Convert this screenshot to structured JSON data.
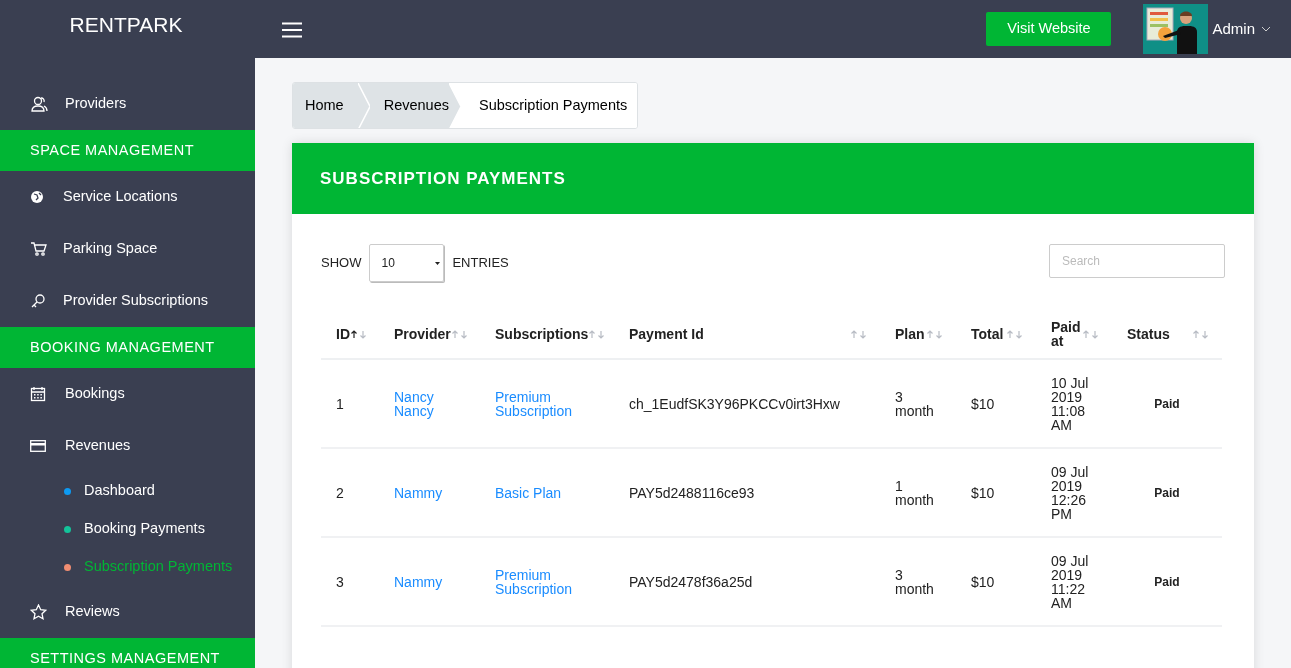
{
  "brand": "RENTPARK",
  "header": {
    "visit_button": "Visit Website",
    "user": "Admin"
  },
  "sidebar": [
    {
      "kind": "item",
      "label": "Providers"
    },
    {
      "kind": "section",
      "label": "SPACE MANAGEMENT"
    },
    {
      "kind": "item",
      "label": "Service Locations"
    },
    {
      "kind": "item",
      "label": "Parking Space"
    },
    {
      "kind": "item",
      "label": "Provider Subscriptions"
    },
    {
      "kind": "section",
      "label": "BOOKING MANAGEMENT"
    },
    {
      "kind": "item",
      "label": "Bookings"
    },
    {
      "kind": "item",
      "label": "Revenues"
    },
    {
      "kind": "subitem",
      "label": "Dashboard",
      "color": "#0d9af2",
      "selected": false
    },
    {
      "kind": "subitem",
      "label": "Booking Payments",
      "color": "#13c39a",
      "selected": false
    },
    {
      "kind": "subitem",
      "label": "Subscription Payments",
      "color": "#f08d72",
      "selected": true
    },
    {
      "kind": "item",
      "label": "Reviews"
    },
    {
      "kind": "section",
      "label": "SETTINGS MANAGEMENT"
    }
  ],
  "breadcrumb": [
    "Home",
    "Revenues",
    "Subscription Payments"
  ],
  "card_title": "SUBSCRIPTION PAYMENTS",
  "show_label": "SHOW",
  "entries_value": "10",
  "entries_label": "ENTRIES",
  "search": {
    "placeholder": "Search"
  },
  "table": {
    "columns": [
      {
        "label": "ID",
        "sorted": true
      },
      {
        "label": "Provider",
        "sorted": false
      },
      {
        "label": "Subscriptions",
        "sorted": false
      },
      {
        "label": "Payment Id",
        "sorted": false
      },
      {
        "label": "Plan",
        "sorted": false
      },
      {
        "label": "Total",
        "sorted": false
      },
      {
        "label": "Paid at",
        "sorted": false
      },
      {
        "label": "Status",
        "sorted": false
      }
    ],
    "rows": [
      {
        "id": "1",
        "provider": "Nancy Nancy",
        "subscription": "Premium Subscription",
        "payment_id": "ch_1EudfSK3Y96PKCCv0irt3Hxw",
        "plan": "3 month",
        "total": "$10",
        "paid_at": "10 Jul 2019 11:08 AM",
        "status": "Paid"
      },
      {
        "id": "2",
        "provider": "Nammy",
        "subscription": "Basic Plan",
        "payment_id": "PAY5d2488116ce93",
        "plan": "1 month",
        "total": "$10",
        "paid_at": "09 Jul 2019 12:26 PM",
        "status": "Paid"
      },
      {
        "id": "3",
        "provider": "Nammy",
        "subscription": "Premium Subscription",
        "payment_id": "PAY5d2478f36a25d",
        "plan": "3 month",
        "total": "$10",
        "paid_at": "09 Jul 2019 11:22 AM",
        "status": "Paid"
      }
    ]
  }
}
